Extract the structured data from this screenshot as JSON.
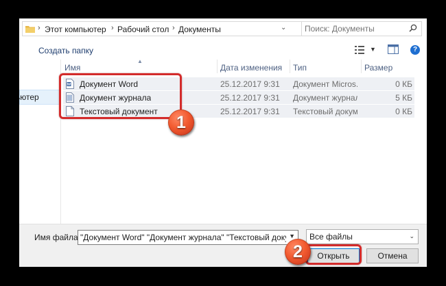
{
  "address_bar": {
    "breadcrumbs": [
      "Этот компьютер",
      "Рабочий стол",
      "Документы"
    ],
    "search_placeholder": "Поиск: Документы"
  },
  "toolbar": {
    "new_folder_label": "Создать папку"
  },
  "nav": {
    "items": [
      {
        "label": "ьютер",
        "selected": true
      }
    ]
  },
  "file_list": {
    "columns": {
      "name": "Имя",
      "date": "Дата изменения",
      "type": "Тип",
      "size": "Размер"
    },
    "rows": [
      {
        "name": "Документ Word",
        "date": "25.12.2017 9:31",
        "type": "Документ Micros...",
        "size": "0 КБ",
        "icon": "word-document-icon"
      },
      {
        "name": "Документ журнала",
        "date": "25.12.2017 9:31",
        "type": "Документ журнала",
        "size": "5 КБ",
        "icon": "journal-document-icon"
      },
      {
        "name": "Текстовый документ",
        "date": "25.12.2017 9:31",
        "type": "Текстовый докум...",
        "size": "0 КБ",
        "icon": "text-document-icon"
      }
    ]
  },
  "bottom": {
    "filename_label": "Имя файла:",
    "filename_value": "\"Документ Word\" \"Документ журнала\" \"Текстовый документ\"",
    "filetype_value": "Все файлы",
    "open_label": "Открыть",
    "cancel_label": "Отмена"
  },
  "annotations": {
    "badge1": "1",
    "badge2": "2",
    "color": "#d32b2b"
  }
}
